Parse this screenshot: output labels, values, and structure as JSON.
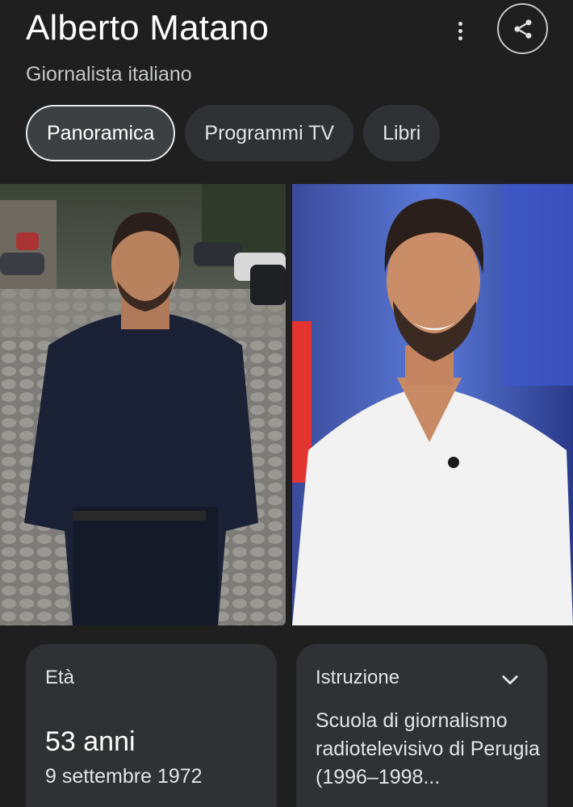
{
  "header": {
    "title": "Alberto Matano",
    "subtitle": "Giornalista italiano",
    "menu_icon": "more-vert-icon",
    "share_icon": "share-icon"
  },
  "tabs": [
    {
      "label": "Panoramica",
      "active": true
    },
    {
      "label": "Programmi TV",
      "active": false
    },
    {
      "label": "Libri",
      "active": false
    }
  ],
  "images": [
    {
      "subject": "Alberto Matano in dark shirt on cobblestone street"
    },
    {
      "subject": "Alberto Matano in white shirt in TV studio"
    }
  ],
  "cards": {
    "age": {
      "label": "Età",
      "value": "53 anni",
      "detail": "9 settembre 1972"
    },
    "education": {
      "label": "Istruzione",
      "value": "Scuola di giornalismo radiotelevisivo di Perugia (1996–1998..."
    }
  },
  "colors": {
    "background": "#1f1f1f",
    "card": "#303134",
    "chip_active_border": "#e8eaed"
  }
}
